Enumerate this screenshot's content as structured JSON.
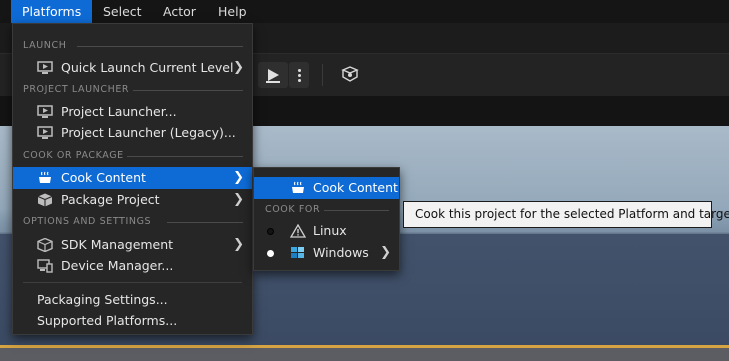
{
  "menubar": {
    "items": [
      {
        "label": "Platforms",
        "active": true
      },
      {
        "label": "Select"
      },
      {
        "label": "Actor"
      },
      {
        "label": "Help"
      }
    ]
  },
  "menu": {
    "sections": {
      "launch": "LAUNCH",
      "project_launcher": "PROJECT LAUNCHER",
      "cook_or_package": "COOK OR PACKAGE",
      "options_and_settings": "OPTIONS AND SETTINGS"
    },
    "items": {
      "quick_launch": {
        "label": "Quick Launch Current Level",
        "icon": "monitor-icon"
      },
      "project_launcher": {
        "label": "Project Launcher...",
        "icon": "monitor-icon"
      },
      "project_launcher_legacy": {
        "label": "Project Launcher (Legacy)...",
        "icon": "monitor-icon"
      },
      "cook_content": {
        "label": "Cook Content",
        "icon": "cooking-pot-icon"
      },
      "package_project": {
        "label": "Package Project",
        "icon": "package-icon"
      },
      "sdk_management": {
        "label": "SDK Management",
        "icon": "cube-icon"
      },
      "device_manager": {
        "label": "Device Manager...",
        "icon": "devices-icon"
      },
      "packaging_settings": {
        "label": "Packaging Settings..."
      },
      "supported_platforms": {
        "label": "Supported Platforms..."
      }
    },
    "highlight_color": "#0e6bd6"
  },
  "submenu": {
    "cook_content": {
      "label": "Cook Content",
      "icon": "cooking-pot-icon"
    },
    "section_cook_for": "COOK FOR",
    "linux": {
      "label": "Linux",
      "icon": "warning-icon",
      "selected": false
    },
    "windows": {
      "label": "Windows",
      "icon": "windows-icon",
      "selected": true
    }
  },
  "tooltip": {
    "text": "Cook this project for the selected Platform and target"
  }
}
